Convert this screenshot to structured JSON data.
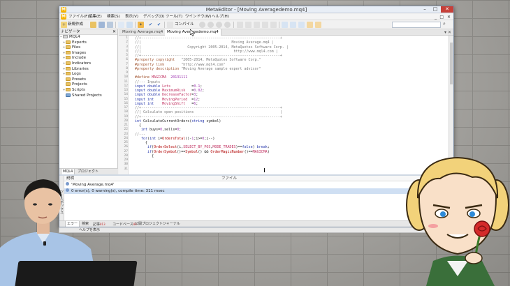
{
  "window": {
    "title": "MetaEditor - [Moving Averagedemo.mq4]",
    "min": "–",
    "max": "□",
    "close": "✕"
  },
  "menu": {
    "items": [
      "ファイル(F)",
      "編集(E)",
      "検索(S)",
      "表示(V)",
      "デバッグ(D)",
      "ツール(T)",
      "ウインドウ(W)",
      "ヘルプ(H)"
    ],
    "mdi": [
      "_",
      "□",
      "✕"
    ]
  },
  "toolbar": {
    "new_label": "新規作成",
    "compile_label": "コンパイル"
  },
  "navigator": {
    "header": "ナビゲータ",
    "close": "✕",
    "root": "MQL4",
    "folders": [
      "Experts",
      "Files",
      "Images",
      "Include",
      "Indicators",
      "Libraries",
      "Logs",
      "Presets",
      "Projects",
      "Scripts"
    ],
    "shared": "Shared Projects",
    "tabs": [
      "MQL4",
      "プロジェクト"
    ]
  },
  "editor": {
    "tabs": [
      "Moving Average.mq4",
      "Moving Averagedemo.mq4"
    ],
    "tab_ctrl": "▾ ✕",
    "lines": [
      {
        "n": "1",
        "parts": [
          [
            "t-c",
            "//+------------------------------------------------------------------+"
          ]
        ]
      },
      {
        "n": "2",
        "parts": [
          [
            "t-c",
            "//|                                           Moving Average.mq4 |"
          ]
        ]
      },
      {
        "n": "3",
        "parts": [
          [
            "t-c",
            "//|                      Copyright 2005-2014, MetaQuotes Software Corp. |"
          ]
        ]
      },
      {
        "n": "4",
        "parts": [
          [
            "t-c",
            "//|                                            http://www.mql4.com |"
          ]
        ]
      },
      {
        "n": "5",
        "parts": [
          [
            "t-c",
            "//+------------------------------------------------------------------+"
          ]
        ]
      },
      {
        "n": "6",
        "parts": [
          [
            "t-d",
            "#property copyright"
          ],
          [
            "t-s",
            "   \"2005-2014, MetaQuotes Software Corp.\""
          ]
        ]
      },
      {
        "n": "7",
        "parts": [
          [
            "t-d",
            "#property link"
          ],
          [
            "t-s",
            "        \"http://www.mql4.com\""
          ]
        ]
      },
      {
        "n": "8",
        "parts": [
          [
            "t-d",
            "#property description"
          ],
          [
            "t-s",
            " \"Moving Average sample expert advisor\""
          ]
        ]
      },
      {
        "n": "9",
        "parts": [
          [
            "t-p",
            ""
          ]
        ]
      },
      {
        "n": "10",
        "parts": [
          [
            "t-d",
            "#define"
          ],
          [
            "t-m",
            " MAGICMA"
          ],
          [
            "t-n",
            "  20131111"
          ]
        ]
      },
      {
        "n": "11",
        "parts": [
          [
            "t-c",
            "//--- Inputs"
          ]
        ]
      },
      {
        "n": "12",
        "parts": [
          [
            "t-k",
            "input double"
          ],
          [
            "t-m",
            " Lots"
          ],
          [
            "t-p",
            "          ="
          ],
          [
            "t-n",
            "0.1"
          ],
          [
            "t-p",
            ";"
          ]
        ]
      },
      {
        "n": "13",
        "parts": [
          [
            "t-k",
            "input double"
          ],
          [
            "t-m",
            " MaximumRisk"
          ],
          [
            "t-p",
            "   ="
          ],
          [
            "t-n",
            "0.02"
          ],
          [
            "t-p",
            ";"
          ]
        ]
      },
      {
        "n": "14",
        "parts": [
          [
            "t-k",
            "input double"
          ],
          [
            "t-m",
            " DecreaseFactor"
          ],
          [
            "t-p",
            "="
          ],
          [
            "t-n",
            "3"
          ],
          [
            "t-p",
            ";"
          ]
        ]
      },
      {
        "n": "15",
        "parts": [
          [
            "t-k",
            "input int"
          ],
          [
            "t-m",
            "    MovingPeriod"
          ],
          [
            "t-p",
            "  ="
          ],
          [
            "t-n",
            "12"
          ],
          [
            "t-p",
            ";"
          ]
        ]
      },
      {
        "n": "16",
        "parts": [
          [
            "t-k",
            "input int"
          ],
          [
            "t-m",
            "    MovingShift"
          ],
          [
            "t-p",
            "   ="
          ],
          [
            "t-n",
            "6"
          ],
          [
            "t-p",
            ";"
          ]
        ]
      },
      {
        "n": "17",
        "parts": [
          [
            "t-c",
            "//+------------------------------------------------------------------+"
          ]
        ]
      },
      {
        "n": "18",
        "parts": [
          [
            "t-c",
            "//| Calculate open positions                                         |"
          ]
        ]
      },
      {
        "n": "19",
        "parts": [
          [
            "t-c",
            "//+------------------------------------------------------------------+"
          ]
        ]
      },
      {
        "n": "20",
        "parts": [
          [
            "t-k",
            "int"
          ],
          [
            "t-p",
            " CalculateCurrentOrders("
          ],
          [
            "t-k",
            "string"
          ],
          [
            "t-p",
            " symbol)"
          ]
        ]
      },
      {
        "n": "21",
        "parts": [
          [
            "t-p",
            "  {"
          ]
        ]
      },
      {
        "n": "22",
        "parts": [
          [
            "t-k",
            "   int"
          ],
          [
            "t-p",
            " buys="
          ],
          [
            "t-n",
            "0"
          ],
          [
            "t-p",
            ",sells="
          ],
          [
            "t-n",
            "0"
          ],
          [
            "t-p",
            ";"
          ]
        ]
      },
      {
        "n": "23",
        "parts": [
          [
            "t-c",
            "//---"
          ]
        ]
      },
      {
        "n": "24",
        "parts": [
          [
            "t-k",
            "   for"
          ],
          [
            "t-p",
            "("
          ],
          [
            "t-k",
            "int"
          ],
          [
            "t-p",
            " i="
          ],
          [
            "t-f",
            "OrdersTotal"
          ],
          [
            "t-p",
            "()-"
          ],
          [
            "t-n",
            "1"
          ],
          [
            "t-p",
            ";i>="
          ],
          [
            "t-n",
            "0"
          ],
          [
            "t-p",
            ";i--)"
          ]
        ]
      },
      {
        "n": "25",
        "parts": [
          [
            "t-p",
            "     {"
          ]
        ]
      },
      {
        "n": "26",
        "parts": [
          [
            "t-k",
            "      if"
          ],
          [
            "t-p",
            "("
          ],
          [
            "t-f",
            "OrderSelect"
          ],
          [
            "t-p",
            "(i,"
          ],
          [
            "t-m",
            "SELECT_BY_POS"
          ],
          [
            "t-p",
            ","
          ],
          [
            "t-m",
            "MODE_TRADES"
          ],
          [
            "t-p",
            ")=="
          ],
          [
            "t-k",
            "false"
          ],
          [
            "t-p",
            ") "
          ],
          [
            "t-k",
            "break"
          ],
          [
            "t-p",
            ";"
          ]
        ]
      },
      {
        "n": "27",
        "parts": [
          [
            "t-k",
            "      if"
          ],
          [
            "t-p",
            "("
          ],
          [
            "t-f",
            "OrderSymbol"
          ],
          [
            "t-p",
            "()=="
          ],
          [
            "t-f",
            "Symbol"
          ],
          [
            "t-p",
            "() && "
          ],
          [
            "t-f",
            "OrderMagicNumber"
          ],
          [
            "t-p",
            "()=="
          ],
          [
            "t-m",
            "MAGICMA"
          ],
          [
            "t-p",
            ")"
          ]
        ]
      },
      {
        "n": "28",
        "parts": [
          [
            "t-p",
            "        {"
          ]
        ]
      },
      {
        "n": "29",
        "parts": [
          [
            "t-p",
            ""
          ]
        ]
      },
      {
        "n": "30",
        "parts": [
          [
            "t-p",
            ""
          ]
        ]
      },
      {
        "n": "31",
        "parts": [
          [
            "t-p",
            ""
          ]
        ]
      }
    ]
  },
  "toolbox": {
    "side_label": "ツールボックス",
    "columns": [
      "説明",
      "ファイル"
    ],
    "messages": [
      {
        "text": "'Moving Average.mq4'",
        "selected": false
      },
      {
        "text": "0 error(s), 0 warning(s), compile time: 311 msec",
        "selected": true
      }
    ],
    "tabs": [
      {
        "label": "エラー",
        "badge": ""
      },
      {
        "label": "検索",
        "badge": ""
      },
      {
        "label": "記事",
        "badge": "813"
      },
      {
        "label": "コードベース",
        "badge": "88"
      },
      {
        "label": "公開プロジェクト",
        "badge": ""
      },
      {
        "label": "ジャーナル",
        "badge": ""
      }
    ]
  },
  "statusbar": {
    "text": "ヘルプを表示"
  },
  "colors": {
    "comment": "#7b7b7b",
    "directive": "#a0522d",
    "keyword": "#2233aa",
    "number": "#a23cb4",
    "function": "#b00000",
    "macro": "#c03060",
    "selection": "#cfdff3"
  }
}
